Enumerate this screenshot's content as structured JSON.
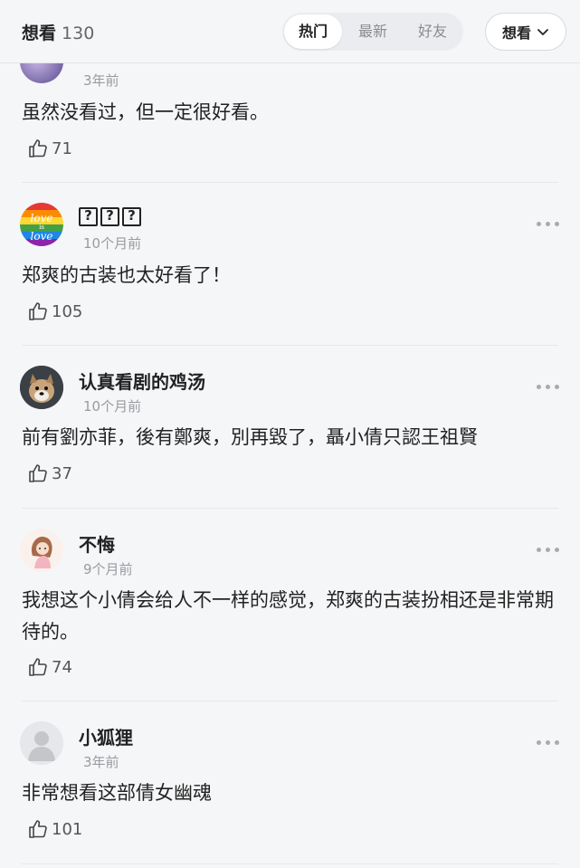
{
  "header": {
    "title": "想看",
    "count": "130",
    "tabs": [
      "热门",
      "最新",
      "好友"
    ],
    "active_tab": "热门",
    "filter_label": "想看"
  },
  "comments": [
    {
      "name": "",
      "time": "3年前",
      "text": "虽然没看过，但一定很好看。",
      "likes": "71",
      "avatar": "purple-avatar"
    },
    {
      "name": "???",
      "time": "10个月前",
      "text": "郑爽的古装也太好看了！",
      "likes": "105",
      "avatar": "rainbow-love-avatar"
    },
    {
      "name": "认真看剧的鸡汤",
      "time": "10个月前",
      "text": "前有劉亦菲，後有鄭爽，別再毀了，聶小倩只認王祖賢",
      "likes": "37",
      "avatar": "dog-avatar"
    },
    {
      "name": "不悔",
      "time": "9个月前",
      "text": "我想这个小倩会给人不一样的感觉，郑爽的古装扮相还是非常期待的。",
      "likes": "74",
      "avatar": "girl-avatar"
    },
    {
      "name": "小狐狸",
      "time": "3年前",
      "text": "非常想看这部倩女幽魂",
      "likes": "101",
      "avatar": "default-avatar"
    }
  ],
  "colors": {
    "background": "#f5f6f8",
    "text": "#222222",
    "muted": "#9a9b9f"
  }
}
